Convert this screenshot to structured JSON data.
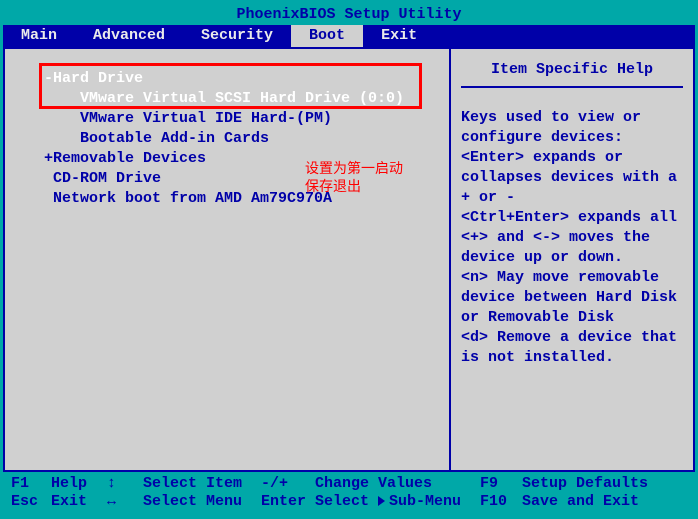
{
  "title": "PhoenixBIOS Setup Utility",
  "menu": {
    "items": [
      "Main",
      "Advanced",
      "Security",
      "Boot",
      "Exit"
    ],
    "active_index": 3
  },
  "boot": {
    "items": [
      {
        "indent": 1,
        "prefix": "-",
        "label": "Hard Drive",
        "selected": true
      },
      {
        "indent": 2,
        "prefix": "",
        "label": "VMware Virtual SCSI Hard Drive (0:0)",
        "selected": true
      },
      {
        "indent": 2,
        "prefix": "",
        "label": "VMware Virtual IDE Hard-(PM)",
        "selected": false
      },
      {
        "indent": 2,
        "prefix": "",
        "label": "Bootable Add-in Cards",
        "selected": false
      },
      {
        "indent": 1,
        "prefix": "+",
        "label": "Removable Devices",
        "selected": false
      },
      {
        "indent": 1,
        "prefix": "",
        "label": "CD-ROM Drive",
        "selected": false
      },
      {
        "indent": 1,
        "prefix": "",
        "label": "Network boot from AMD Am79C970A",
        "selected": false
      }
    ]
  },
  "annotation": "设置为第一启动\n保存退出",
  "help": {
    "title": "Item Specific Help",
    "body": "Keys used to view or configure devices:\n<Enter> expands or collapses devices with a + or -\n<Ctrl+Enter> expands all\n<+> and <-> moves the device up or down.\n<n> May move removable device between Hard Disk or Removable Disk\n<d> Remove a device that is not installed."
  },
  "footer": {
    "row1": {
      "key1": "F1",
      "label1": "Help",
      "arrow": "updown",
      "action1": "Select Item",
      "op": "-/+",
      "desc": "Change Values",
      "key2": "F9",
      "label2": "Setup Defaults"
    },
    "row2": {
      "key1": "Esc",
      "label1": "Exit",
      "arrow": "leftright",
      "action1": "Select Menu",
      "op": "Enter",
      "desc_pre": "Select",
      "desc_post": "Sub-Menu",
      "key2": "F10",
      "label2": "Save and Exit"
    }
  }
}
